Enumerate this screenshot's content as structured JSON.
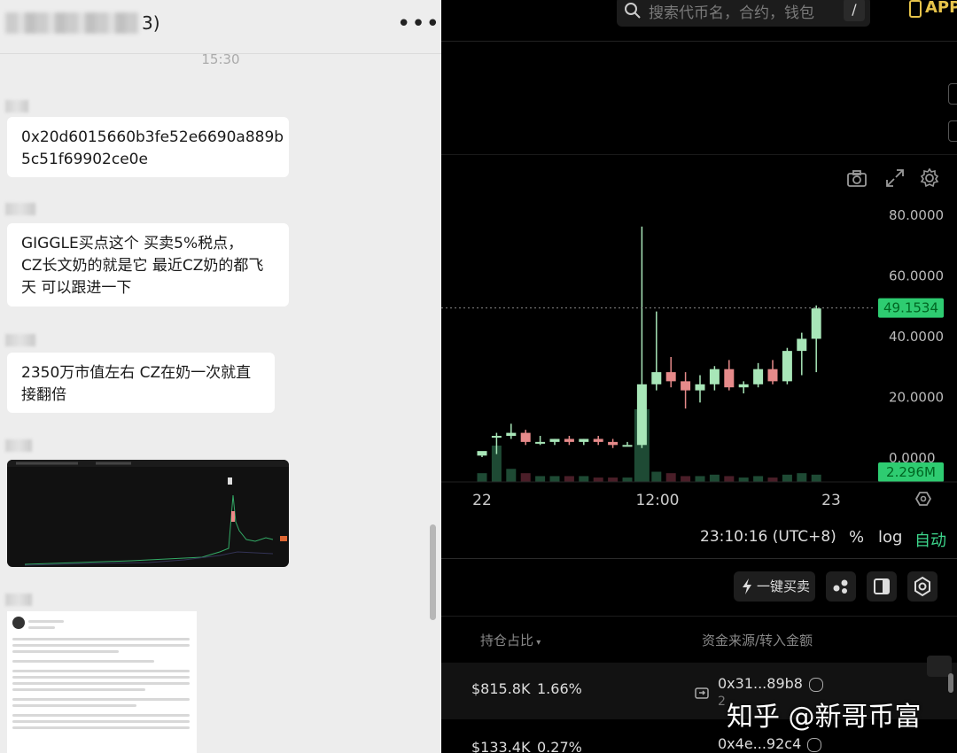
{
  "chat": {
    "title_suffix": "3)",
    "time": "15:30",
    "messages": [
      {
        "lines": [
          "0x20d6015660b3fe52e6690a889b",
          "5c51f69902ce0e"
        ]
      },
      {
        "lines": [
          "GIGGLE买点这个  买卖5%税点，",
          "CZ长文奶的就是它  最近CZ奶的都飞",
          "天  可以跟进一下"
        ]
      },
      {
        "lines": [
          "2350万市值左右  CZ在奶一次就直",
          "接翻倍"
        ]
      }
    ]
  },
  "trade": {
    "search_placeholder": "搜索代币名，合约，钱包",
    "search_shortcut": "/",
    "app_label": "APP",
    "price_label": "49.1534",
    "volume_label": "2.296M",
    "time_display": "23:10:16 (UTC+8)",
    "percent_label": "%",
    "log_label": "log",
    "auto_label": "自动",
    "quick_trade": "一键买卖",
    "columns": {
      "holding": "持仓占比",
      "source": "资金来源/转入金额"
    },
    "rows": [
      {
        "value": "$815.8K",
        "pct": "1.66%",
        "addr": "0x31...89b8",
        "sub": "2"
      },
      {
        "value": "$133.4K",
        "pct": "0.27%",
        "addr": "0x4e...92c4"
      }
    ],
    "colors": {
      "up": "#a8e6b8",
      "down": "#e68a8a",
      "accent": "#3dd68c",
      "label_bg": "#2ecc71"
    }
  },
  "chart_data": {
    "type": "candlestick",
    "y_ticks": [
      "80.0000",
      "60.0000",
      "40.0000",
      "20.0000",
      "0.0000"
    ],
    "ylim": [
      0,
      80
    ],
    "x_ticks": [
      "22",
      "12:00",
      "23"
    ],
    "last_price": 49.1534,
    "candles": [
      {
        "o": 0.5,
        "h": 1,
        "l": 0,
        "c": 2,
        "v": 0.6
      },
      {
        "o": 7,
        "h": 8,
        "l": 1,
        "c": 7,
        "v": 2.5
      },
      {
        "o": 7,
        "h": 11,
        "l": 6,
        "c": 8,
        "v": 0.9
      },
      {
        "o": 8,
        "h": 9,
        "l": 4,
        "c": 5,
        "v": 0.6
      },
      {
        "o": 5,
        "h": 7,
        "l": 4,
        "c": 5,
        "v": 0.4
      },
      {
        "o": 5,
        "h": 6,
        "l": 4,
        "c": 6,
        "v": 0.4
      },
      {
        "o": 6,
        "h": 7,
        "l": 4,
        "c": 5,
        "v": 0.4
      },
      {
        "o": 5,
        "h": 6,
        "l": 4,
        "c": 6,
        "v": 0.4
      },
      {
        "o": 6,
        "h": 7,
        "l": 4,
        "c": 5,
        "v": 0.3
      },
      {
        "o": 5,
        "h": 6,
        "l": 3,
        "c": 4,
        "v": 0.3
      },
      {
        "o": 4,
        "h": 5,
        "l": 4,
        "c": 4,
        "v": 0.3
      },
      {
        "o": 4,
        "h": 76,
        "l": 3,
        "c": 24,
        "v": 5.0
      },
      {
        "o": 24,
        "h": 48,
        "l": 22,
        "c": 28,
        "v": 0.7
      },
      {
        "o": 28,
        "h": 33,
        "l": 23,
        "c": 25,
        "v": 0.6
      },
      {
        "o": 25,
        "h": 28,
        "l": 16,
        "c": 22,
        "v": 0.4
      },
      {
        "o": 22,
        "h": 27,
        "l": 18,
        "c": 24,
        "v": 0.4
      },
      {
        "o": 24,
        "h": 30,
        "l": 22,
        "c": 29,
        "v": 0.5
      },
      {
        "o": 29,
        "h": 32,
        "l": 22,
        "c": 23,
        "v": 0.4
      },
      {
        "o": 23,
        "h": 25,
        "l": 21,
        "c": 24,
        "v": 0.3
      },
      {
        "o": 24,
        "h": 31,
        "l": 23,
        "c": 29,
        "v": 0.4
      },
      {
        "o": 29,
        "h": 32,
        "l": 24,
        "c": 25,
        "v": 0.3
      },
      {
        "o": 25,
        "h": 36,
        "l": 24,
        "c": 35,
        "v": 0.5
      },
      {
        "o": 35,
        "h": 41,
        "l": 27,
        "c": 39,
        "v": 0.6
      },
      {
        "o": 39,
        "h": 50,
        "l": 28,
        "c": 49,
        "v": 0.5
      }
    ]
  },
  "watermark": "知乎 @新哥币富"
}
